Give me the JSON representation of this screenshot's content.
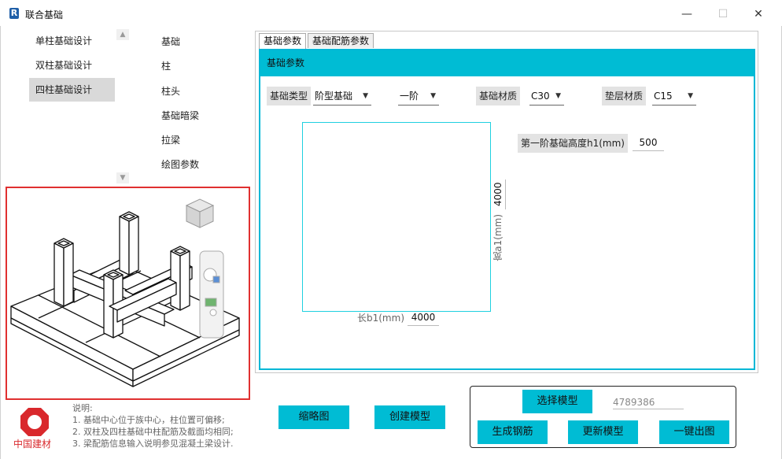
{
  "window": {
    "app_icon_letter": "R",
    "title": "联合基础",
    "minimize": "—",
    "maximize": "☐",
    "close": "✕"
  },
  "nav": {
    "items": [
      {
        "label": "单柱基础设计"
      },
      {
        "label": "双柱基础设计"
      },
      {
        "label": "四柱基础设计"
      }
    ],
    "selected": "四柱基础设计",
    "sub_items": [
      {
        "label": "基础"
      },
      {
        "label": "柱"
      },
      {
        "label": "柱头"
      },
      {
        "label": "基础暗梁"
      },
      {
        "label": "拉梁"
      },
      {
        "label": "绘图参数"
      }
    ]
  },
  "logo": {
    "text": "中国建材",
    "color": "#d9282c"
  },
  "notes": {
    "heading": "说明:",
    "lines": [
      "1. 基础中心位于族中心，柱位置可偏移;",
      "2. 双柱及四柱基础中柱配筋及截面均相同;",
      "3. 梁配筋信息输入说明参见混凝土梁设计."
    ]
  },
  "tabs": [
    {
      "label": "基础参数",
      "active": true
    },
    {
      "label": "基础配筋参数",
      "active": false
    }
  ],
  "panel": {
    "header": "基础参数",
    "accent_color": "#00bcd4",
    "foundation_type_label": "基础类型",
    "foundation_type_value": "阶型基础",
    "steps_value": "一阶",
    "material_label": "基础材质",
    "material_value": "C30",
    "cushion_label": "垫层材质",
    "cushion_value": "C15",
    "h1_label": "第一阶基础高度h1(mm)",
    "h1_value": "500",
    "a1_label": "宽a1(mm)",
    "a1_value": "4000",
    "b1_label": "长b1(mm)",
    "b1_value": "4000"
  },
  "buttons": {
    "thumbnail": "缩略图",
    "create_model": "创建模型",
    "select_model": "选择模型",
    "generate_rebar": "生成钢筋",
    "update_model": "更新模型",
    "one_click_drawing": "一键出图"
  },
  "model_id": "4789386",
  "icons": {
    "scroll_up": "up-arrow-icon",
    "scroll_down": "down-arrow-icon",
    "combo_arrow": "triangle-down-icon"
  }
}
